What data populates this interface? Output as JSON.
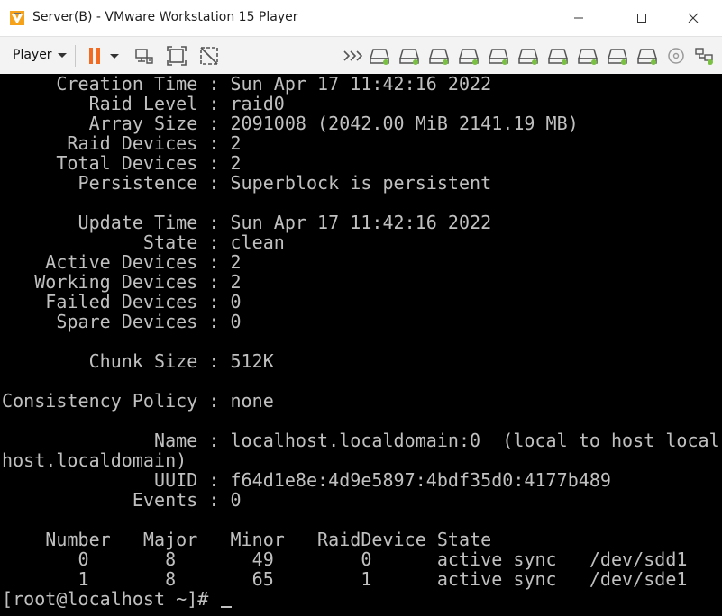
{
  "window": {
    "title": "Server(B) - VMware Workstation 15 Player",
    "minimize_icon": "minimize-icon",
    "maximize_icon": "maximize-icon",
    "close_icon": "close-icon"
  },
  "toolbar": {
    "player_label": "Player",
    "icons": [
      "pause-icon",
      "send-ctrl-alt-del-icon",
      "fit-guest-icon",
      "unity-icon",
      "more-devices-icon",
      "hard-disk-icon",
      "cd-dvd-icon",
      "message-log-icon",
      "network-adapter-icon",
      "usb-icon",
      "sound-icon",
      "printer-icon",
      "display-icon"
    ],
    "accent_color": "#f26b21",
    "device_led_color": "#7ac143"
  },
  "terminal": {
    "lines": [
      "     Creation Time : Sun Apr 17 11:42:16 2022",
      "        Raid Level : raid0",
      "        Array Size : 2091008 (2042.00 MiB 2141.19 MB)",
      "      Raid Devices : 2",
      "     Total Devices : 2",
      "       Persistence : Superblock is persistent",
      "",
      "       Update Time : Sun Apr 17 11:42:16 2022",
      "             State : clean",
      "    Active Devices : 2",
      "   Working Devices : 2",
      "    Failed Devices : 0",
      "     Spare Devices : 0",
      "",
      "        Chunk Size : 512K",
      "",
      "Consistency Policy : none",
      "",
      "              Name : localhost.localdomain:0  (local to host local",
      "host.localdomain)",
      "              UUID : f64d1e8e:4d9e5897:4bdf35d0:4177b489",
      "            Events : 0",
      "",
      "    Number   Major   Minor   RaidDevice State",
      "       0       8       49        0      active sync   /dev/sdd1",
      "       1       8       65        1      active sync   /dev/sde1"
    ],
    "prompt": "[root@localhost ~]# "
  }
}
